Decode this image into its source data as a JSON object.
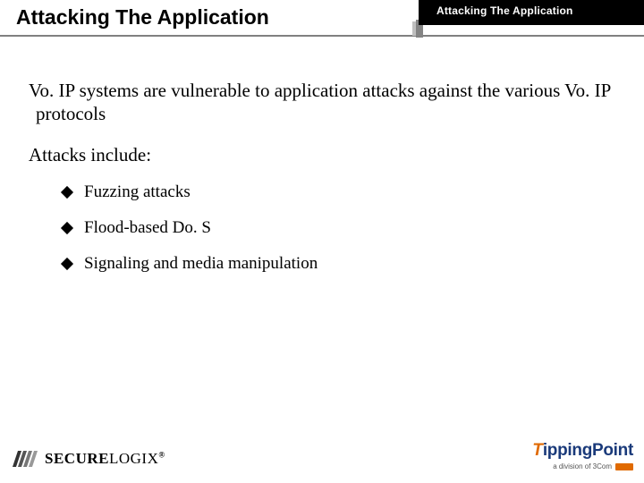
{
  "header": {
    "title": "Attacking The Application",
    "tab": "Attacking The Application"
  },
  "content": {
    "intro": "Vo. IP systems are vulnerable to application attacks against the various Vo. IP protocols",
    "subhead": "Attacks include:",
    "bullets": [
      "Fuzzing attacks",
      "Flood-based Do. S",
      "Signaling and media manipulation"
    ]
  },
  "footer": {
    "left_logo_main": "SECURE",
    "left_logo_sub": "LOGIX",
    "left_logo_reg": "®",
    "right_logo_t": "T",
    "right_logo_rest": "ippingPoint",
    "right_logo_sub": "a division of 3Com"
  }
}
